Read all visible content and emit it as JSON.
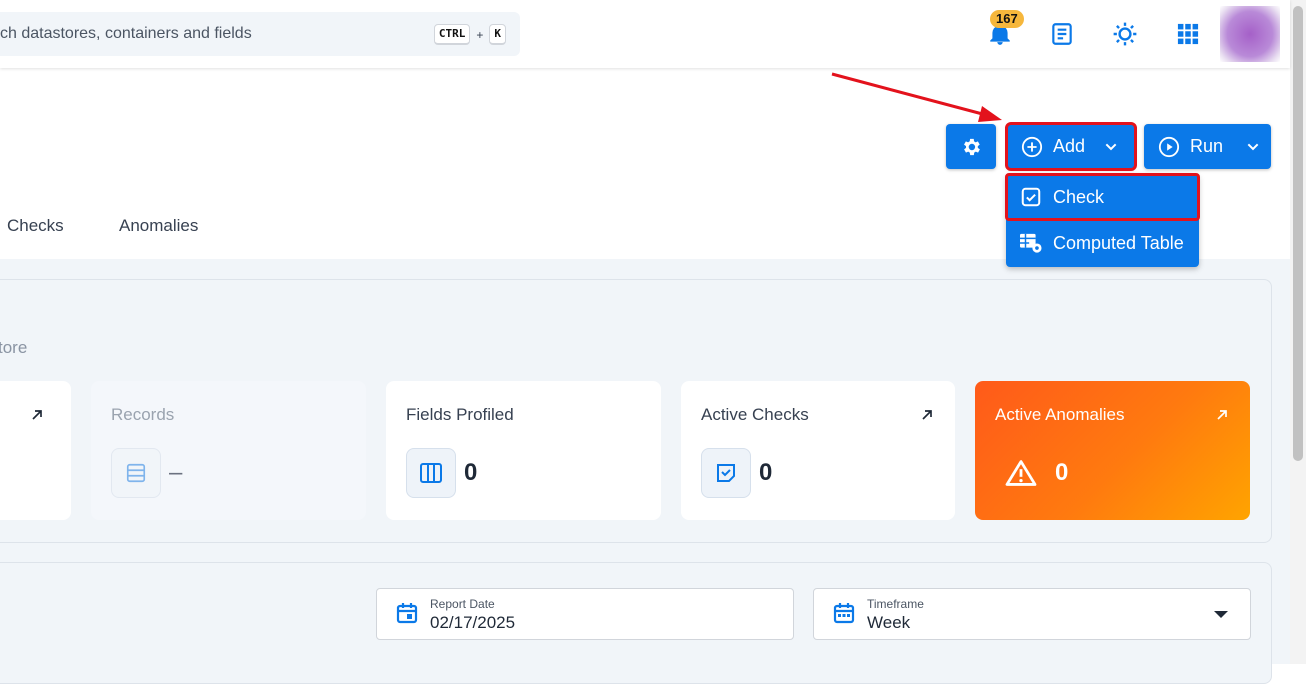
{
  "header": {
    "search_placeholder": "ch datastores, containers and fields",
    "shortcut_ctrl": "CTRL",
    "shortcut_plus": "+",
    "shortcut_k": "K",
    "notification_count": "167",
    "icons": [
      "bell-icon",
      "document-icon",
      "brightness-icon",
      "apps-grid-icon",
      "avatar"
    ]
  },
  "actions": {
    "add_label": "Add",
    "run_label": "Run",
    "menu": [
      {
        "label": "Check",
        "icon": "check-square-icon"
      },
      {
        "label": "Computed Table",
        "icon": "table-cog-icon"
      }
    ]
  },
  "tabs": [
    "Checks",
    "Anomalies"
  ],
  "overview": {
    "section_label": "tore",
    "cards": [
      {
        "title": "Records",
        "value": "–",
        "icon": "rows-icon"
      },
      {
        "title": "Fields Profiled",
        "value": "0",
        "icon": "columns-icon"
      },
      {
        "title": "Active Checks",
        "value": "0",
        "icon": "check-note-icon"
      },
      {
        "title": "Active Anomalies",
        "value": "0",
        "icon": "warning-icon"
      }
    ]
  },
  "filters": {
    "report_date_label": "Report Date",
    "report_date_value": "02/17/2025",
    "timeframe_label": "Timeframe",
    "timeframe_value": "Week"
  },
  "colors": {
    "primary": "#0b79e8",
    "highlight": "#e3121c",
    "anomaly_start": "#ff5a1a",
    "anomaly_end": "#ffa400",
    "badge": "#f6b73c"
  }
}
